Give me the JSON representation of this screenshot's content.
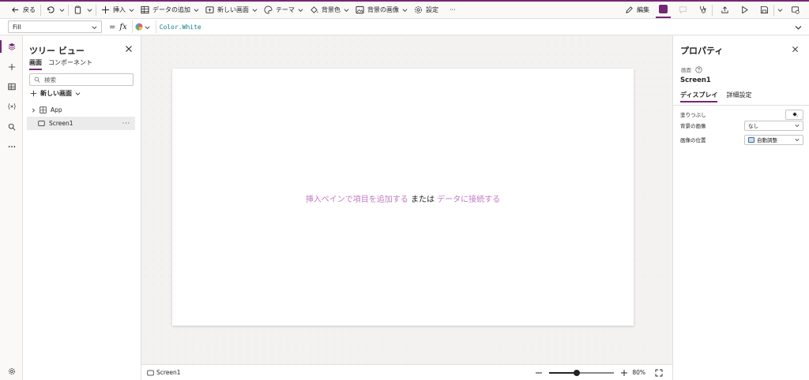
{
  "toolbar": {
    "back": "戻る",
    "insert": "挿入",
    "add_data": "データの追加",
    "new_screen": "新しい画面",
    "theme": "テーマ",
    "background_color": "背景色",
    "background_image": "背景の画像",
    "settings": "設定",
    "more": "···",
    "edit": "編集"
  },
  "formula_bar": {
    "property": "Fill",
    "equals": "=",
    "fx": "fx",
    "formula": "Color.White"
  },
  "tree_view": {
    "title": "ツリー ビュー",
    "tabs": [
      "画面",
      "コンポーネント"
    ],
    "search_placeholder": "検索",
    "new_screen": "新しい画面",
    "items": [
      {
        "label": "App"
      },
      {
        "label": "Screen1"
      }
    ],
    "more": "···"
  },
  "canvas": {
    "hint_link1": "挿入ペインで項目を追加する",
    "hint_or": " または ",
    "hint_link2": "データに接続する"
  },
  "status_bar": {
    "screen": "Screen1",
    "zoom_level": "80%",
    "zoom_fraction": 0.42
  },
  "properties": {
    "title": "プロパティ",
    "type": "画面",
    "name": "Screen1",
    "tabs": [
      "ディスプレイ",
      "詳細設定"
    ],
    "fill_label": "塗りつぶし",
    "bg_image_label": "背景の画像",
    "bg_image_value": "なし",
    "img_pos_label": "画像の位置",
    "img_pos_value": "自動調整"
  },
  "colors": {
    "accent": "#742774",
    "link": "#c27cc2"
  }
}
